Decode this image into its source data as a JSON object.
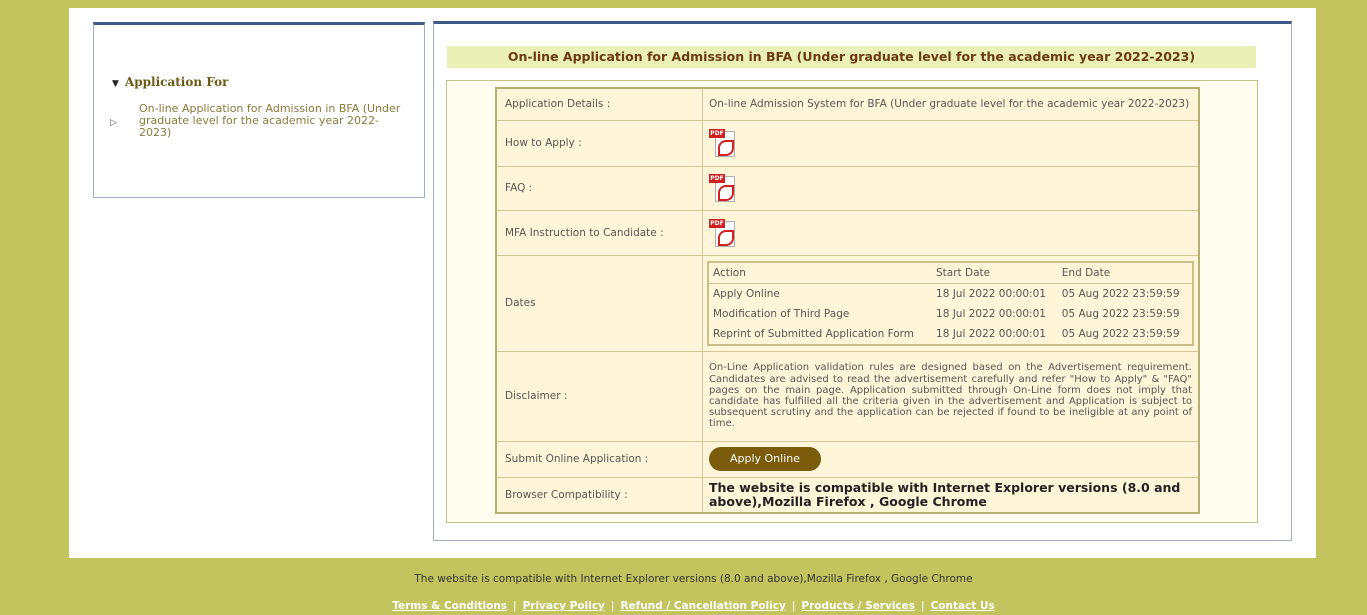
{
  "sidebar": {
    "heading": "Application For",
    "item": "On-line Application for Admission in BFA (Under graduate level for the academic year 2022-2023)"
  },
  "main": {
    "title": "On-line Application for Admission in BFA (Under graduate level for the academic year 2022-2023)",
    "rows": {
      "app_details_label": "Application Details :",
      "app_details_value": "On-line Admission System for BFA (Under graduate level for the academic year 2022-2023)",
      "how_to_apply_label": "How to Apply :",
      "faq_label": "FAQ :",
      "mfa_label": "MFA Instruction to Candidate :",
      "dates_label": "Dates",
      "disclaimer_label": "Disclaimer :",
      "disclaimer_text": "On-Line Application validation rules are designed based on the Advertisement requirement. Candidates are advised to read the advertisement carefully and refer \"How to Apply\" & \"FAQ\" pages on the main page. Application submitted through On-Line form does not imply that candidate has fulfilled all the criteria given in the advertisement and Application is subject to subsequent scrutiny and the application can be rejected if found to be ineligible at any point of time.",
      "submit_label": "Submit Online Application :",
      "apply_button": "Apply Online",
      "browser_label": "Browser Compatibility :",
      "browser_value": "The website is compatible with Internet Explorer versions (8.0 and above),Mozilla Firefox , Google Chrome"
    },
    "dates": {
      "headers": [
        "Action",
        "Start Date",
        "End Date"
      ],
      "rows": [
        [
          "Apply Online",
          "18 Jul 2022 00:00:01",
          "05 Aug 2022 23:59:59"
        ],
        [
          "Modification of Third Page",
          "18 Jul 2022 00:00:01",
          "05 Aug 2022 23:59:59"
        ],
        [
          "Reprint of Submitted Application Form",
          "18 Jul 2022 00:00:01",
          "05 Aug 2022 23:59:59"
        ]
      ]
    },
    "pdf_icon_label": "PDF"
  },
  "footer": {
    "text": "The website is compatible with Internet Explorer versions (8.0 and above),Mozilla Firefox , Google Chrome",
    "links": [
      "Terms & Conditions",
      "Privacy Policy",
      "Refund / Cancellation Policy",
      "Products / Services",
      "Contact Us"
    ],
    "separator": "|"
  },
  "colors": {
    "background": "#c3c45e",
    "title_bar": "#eaf0b8",
    "title_text": "#6b3a10",
    "button": "#7b5c0d",
    "panel_border": "#3e5a86"
  }
}
